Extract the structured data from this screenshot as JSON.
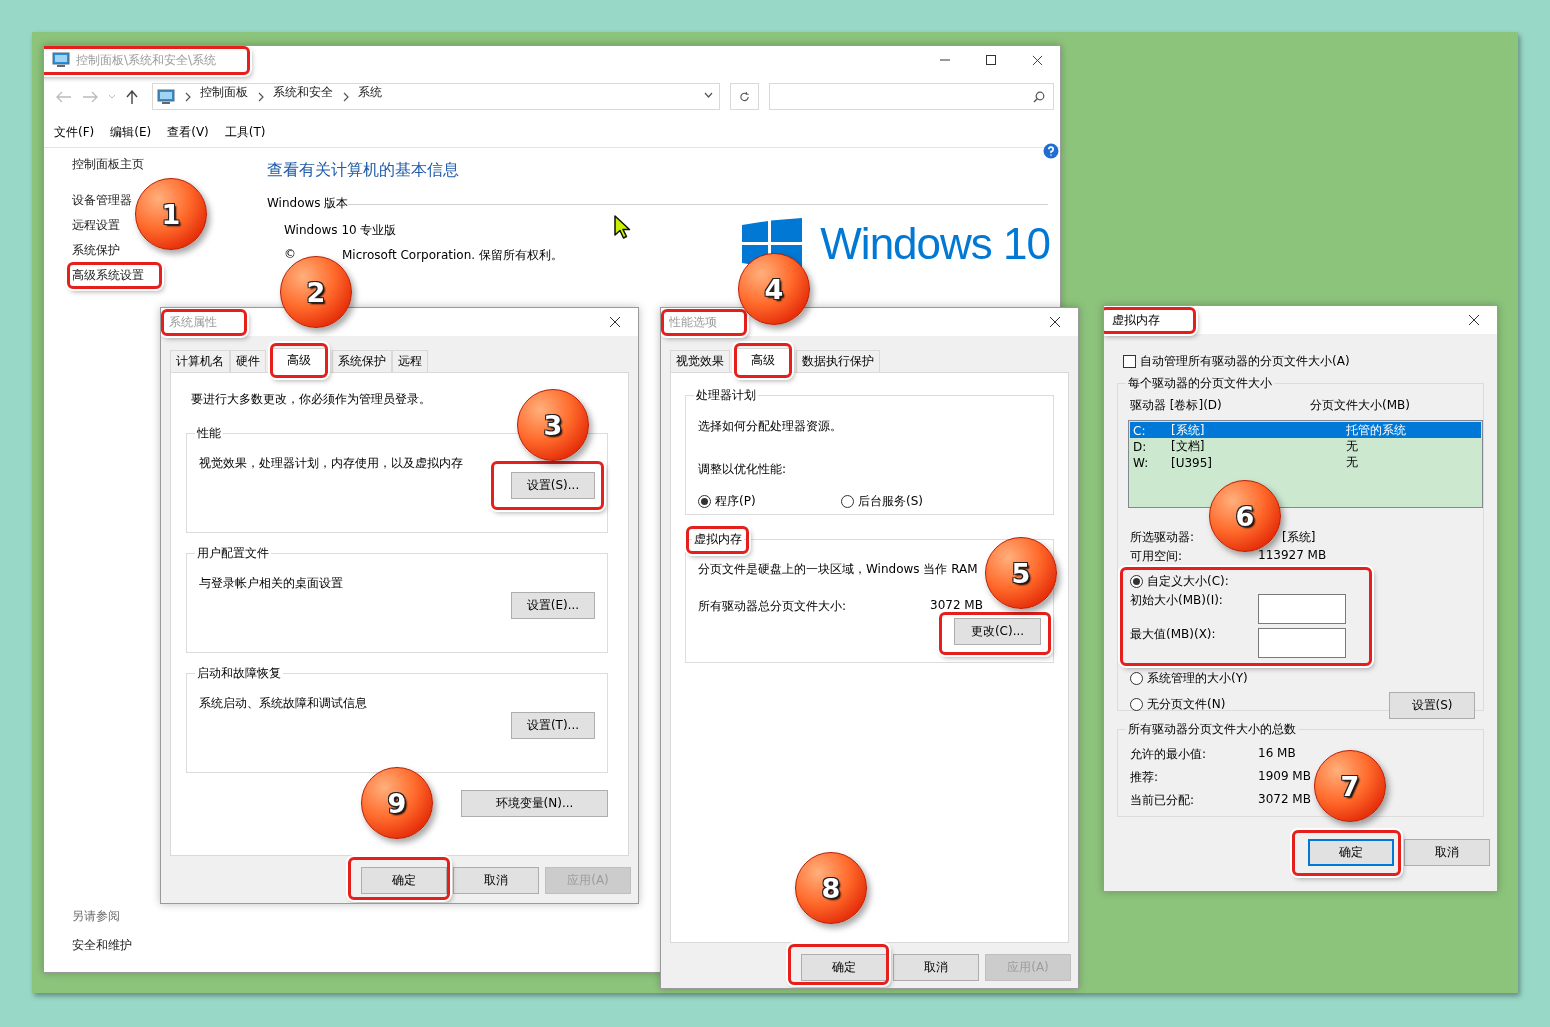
{
  "main_window": {
    "title": "控制面板\\系统和安全\\系统",
    "active": false,
    "breadcrumb": [
      "控制面板",
      "系统和安全",
      "系统"
    ],
    "menu": [
      "文件(F)",
      "编辑(E)",
      "查看(V)",
      "工具(T)"
    ],
    "sidebar": {
      "items": [
        "控制面板主页",
        "设备管理器",
        "远程设置",
        "系统保护",
        "高级系统设置"
      ],
      "see_also": {
        "heading": "另请参阅",
        "links": [
          "安全和维护"
        ]
      }
    },
    "heading": "查看有关计算机的基本信息",
    "edition": {
      "title": "Windows 版本",
      "name": "Windows 10 专业版",
      "copyright_mark": "©",
      "copyright": "Microsoft Corporation. 保留所有权利。",
      "logo_text": "Windows 10"
    }
  },
  "system_properties": {
    "title": "系统属性",
    "active": false,
    "tabs": [
      {
        "label": "计算机名",
        "selected": false
      },
      {
        "label": "硬件",
        "selected": false
      },
      {
        "label": "高级",
        "selected": true
      },
      {
        "label": "系统保护",
        "selected": false
      },
      {
        "label": "远程",
        "selected": false
      }
    ],
    "notice": "要进行大多数更改，你必须作为管理员登录。",
    "groups": [
      {
        "title": "性能",
        "description": "视觉效果，处理器计划，内存使用，以及虚拟内存",
        "button": "设置(S)..."
      },
      {
        "title": "用户配置文件",
        "description": "与登录帐户相关的桌面设置",
        "button": "设置(E)..."
      },
      {
        "title": "启动和故障恢复",
        "description": "系统启动、系统故障和调试信息",
        "button": "设置(T)..."
      }
    ],
    "env_button": "环境变量(N)...",
    "buttons": [
      {
        "label": "确定",
        "disabled": false
      },
      {
        "label": "取消",
        "disabled": false
      },
      {
        "label": "应用(A)",
        "disabled": true
      }
    ]
  },
  "performance_options": {
    "title": "性能选项",
    "active": false,
    "tabs": [
      {
        "label": "视觉效果",
        "selected": false
      },
      {
        "label": "高级",
        "selected": true
      },
      {
        "label": "数据执行保护",
        "selected": false
      }
    ],
    "processor_group": {
      "title": "处理器计划",
      "description": "选择如何分配处理器资源。",
      "prompt": "调整以优化性能:",
      "options": [
        {
          "label": "程序(P)",
          "selected": true
        },
        {
          "label": "后台服务(S)",
          "selected": false
        }
      ]
    },
    "vm_group": {
      "title": "虚拟内存",
      "description": "分页文件是硬盘上的一块区域，Windows 当作 RAM",
      "total_label": "所有驱动器总分页文件大小:",
      "total_value": "3072 MB",
      "button": "更改(C)..."
    },
    "buttons": [
      {
        "label": "确定",
        "disabled": false
      },
      {
        "label": "取消",
        "disabled": false
      },
      {
        "label": "应用(A)",
        "disabled": true
      }
    ]
  },
  "virtual_memory": {
    "title": "虚拟内存",
    "active": true,
    "auto_manage": {
      "label": "自动管理所有驱动器的分页文件大小(A)",
      "checked": false
    },
    "drives_group": {
      "title": "每个驱动器的分页文件大小",
      "columns": [
        "驱动器 [卷标](D)",
        "分页文件大小(MB)"
      ],
      "rows": [
        {
          "drive": "C:",
          "volume": "[系统]",
          "size": "托管的系统",
          "selected": true
        },
        {
          "drive": "D:",
          "volume": "[文档]",
          "size": "无",
          "selected": false
        },
        {
          "drive": "W:",
          "volume": "[U395]",
          "size": "无",
          "selected": false
        }
      ],
      "selected_drive_label": "所选驱动器:",
      "selected_drive_value": "[系统]",
      "free_space_label": "可用空间:",
      "free_space_value": "113927 MB",
      "custom_option": {
        "label": "自定义大小(C):",
        "selected": true
      },
      "initial_size_label": "初始大小(MB)(I):",
      "max_size_label": "最大值(MB)(X):",
      "other_options": [
        {
          "label": "系统管理的大小(Y)",
          "selected": false
        },
        {
          "label": "无分页文件(N)",
          "selected": false
        }
      ],
      "set_button": "设置(S)"
    },
    "totals_group": {
      "title": "所有驱动器分页文件大小的总数",
      "rows": [
        {
          "label": "允许的最小值:",
          "value": "16 MB"
        },
        {
          "label": "推荐:",
          "value": "1909 MB"
        },
        {
          "label": "当前已分配:",
          "value": "3072 MB"
        }
      ]
    },
    "buttons": [
      {
        "label": "确定",
        "disabled": false,
        "focused": true
      },
      {
        "label": "取消",
        "disabled": false,
        "focused": false
      }
    ]
  },
  "annotations": [
    {
      "number": "1"
    },
    {
      "number": "2"
    },
    {
      "number": "3"
    },
    {
      "number": "4"
    },
    {
      "number": "5"
    },
    {
      "number": "6"
    },
    {
      "number": "7"
    },
    {
      "number": "8"
    },
    {
      "number": "9"
    }
  ]
}
